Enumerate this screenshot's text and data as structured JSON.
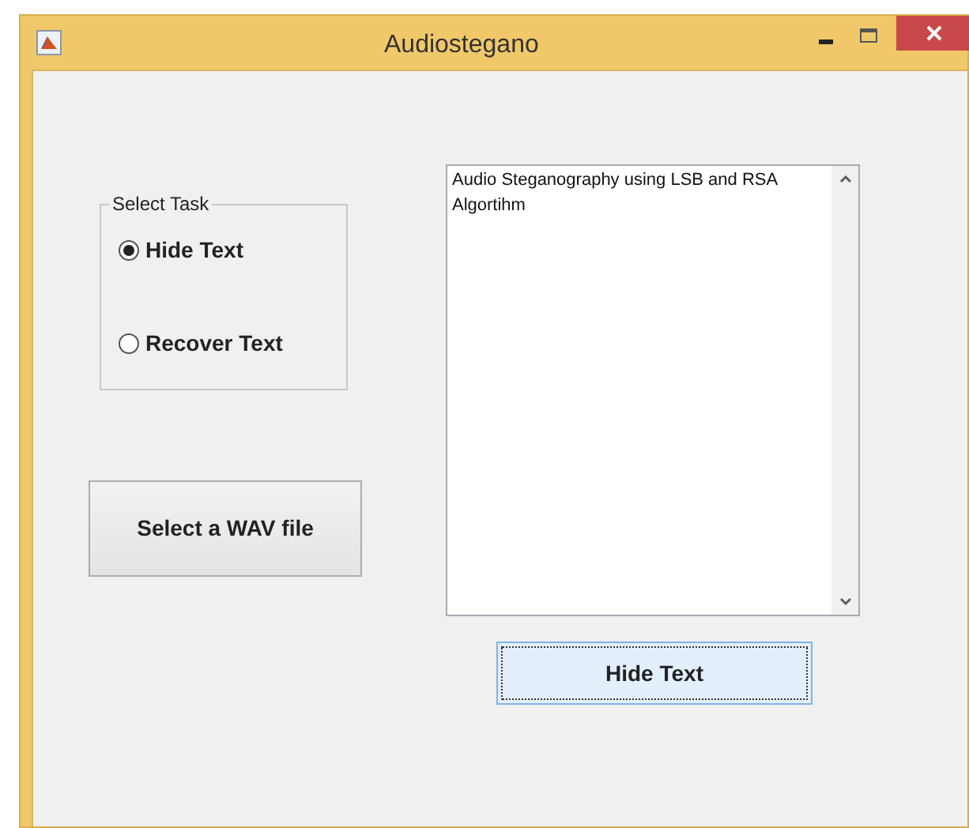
{
  "window": {
    "title": "Audiostegano"
  },
  "task_group": {
    "title": "Select Task",
    "options": [
      {
        "label": "Hide Text",
        "selected": true
      },
      {
        "label": "Recover Text",
        "selected": false
      }
    ]
  },
  "select_button": {
    "label": "Select a WAV file",
    "focused": false
  },
  "text_area": {
    "value": "Audio Steganography using LSB and RSA Algortihm"
  },
  "action_button": {
    "label": "Hide Text",
    "focused": true
  }
}
